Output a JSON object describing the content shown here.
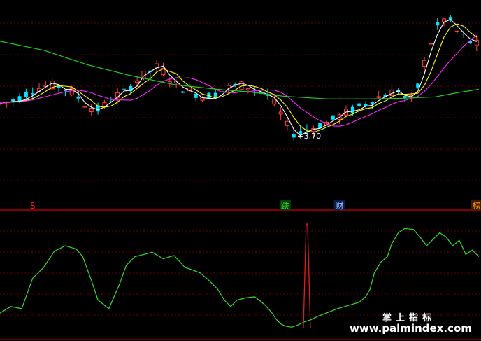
{
  "chart_data": [
    {
      "type": "candlestick",
      "panel": "main",
      "colors": {
        "up": "#ff3c3c",
        "down": "#00e5ff",
        "ma_white": "#ffffff",
        "ma_yellow": "#ffff00",
        "ma_magenta": "#ff22ff",
        "ma_green": "#22cc22",
        "grid": "#7a0000",
        "divider": "#cc0000"
      },
      "ylim": [
        2.6,
        5.6
      ],
      "low_marker": "3.70",
      "event_labels": [
        {
          "text": "S",
          "x": 15,
          "color": "#ff2222"
        },
        {
          "text": "跌",
          "x": 131,
          "color": "#33dd33",
          "bg": "#0b3d0b"
        },
        {
          "text": "财",
          "x": 156,
          "color": "#9bbcff",
          "bg": "#0a1d4d"
        },
        {
          "text": "榜",
          "x": 219,
          "color": "#ff8a00",
          "bg": "#3a1d00"
        }
      ],
      "candles": [],
      "ma_green": [
        [
          0,
          5.06
        ],
        [
          20,
          4.93
        ],
        [
          40,
          4.72
        ],
        [
          60,
          4.56
        ],
        [
          80,
          4.43
        ],
        [
          100,
          4.36
        ],
        [
          115,
          4.32
        ],
        [
          130,
          4.26
        ],
        [
          150,
          4.22
        ],
        [
          170,
          4.22
        ],
        [
          185,
          4.23
        ],
        [
          200,
          4.25
        ],
        [
          210,
          4.31
        ],
        [
          220,
          4.36
        ]
      ]
    },
    {
      "type": "line",
      "panel": "oscillator",
      "ylim": [
        0,
        100
      ],
      "spike": {
        "x": 141,
        "value": 100,
        "color": "#e02020"
      },
      "series": [
        {
          "color": "#33dd33",
          "values": [
            [
              0,
              18
            ],
            [
              5,
              24
            ],
            [
              10,
              22
            ],
            [
              15,
              50
            ],
            [
              20,
              60
            ],
            [
              25,
              75
            ],
            [
              30,
              80
            ],
            [
              35,
              77
            ],
            [
              38,
              70
            ],
            [
              42,
              48
            ],
            [
              45,
              30
            ],
            [
              50,
              22
            ],
            [
              55,
              45
            ],
            [
              58,
              62
            ],
            [
              62,
              70
            ],
            [
              66,
              72
            ],
            [
              70,
              74
            ],
            [
              75,
              68
            ],
            [
              80,
              71
            ],
            [
              85,
              60
            ],
            [
              88,
              58
            ],
            [
              92,
              55
            ],
            [
              96,
              48
            ],
            [
              100,
              40
            ],
            [
              103,
              30
            ],
            [
              106,
              24
            ],
            [
              109,
              30
            ],
            [
              113,
              32
            ],
            [
              117,
              33
            ],
            [
              119,
              30
            ],
            [
              122,
              25
            ],
            [
              125,
              18
            ],
            [
              127,
              12
            ],
            [
              129,
              8
            ],
            [
              131,
              6
            ],
            [
              134,
              5
            ],
            [
              137,
              7
            ],
            [
              140,
              10
            ],
            [
              143,
              12
            ],
            [
              146,
              15
            ],
            [
              150,
              18
            ],
            [
              155,
              22
            ],
            [
              160,
              25
            ],
            [
              165,
              28
            ],
            [
              168,
              33
            ],
            [
              170,
              40
            ],
            [
              172,
              55
            ],
            [
              175,
              65
            ],
            [
              178,
              70
            ],
            [
              180,
              82
            ],
            [
              183,
              92
            ],
            [
              186,
              96
            ],
            [
              190,
              95
            ],
            [
              193,
              88
            ],
            [
              196,
              80
            ],
            [
              199,
              86
            ],
            [
              202,
              92
            ],
            [
              205,
              88
            ],
            [
              208,
              80
            ],
            [
              211,
              85
            ],
            [
              214,
              72
            ],
            [
              217,
              76
            ],
            [
              220,
              70
            ]
          ]
        }
      ]
    }
  ],
  "watermark": {
    "cn": "掌上指标",
    "url": "www.palmindex.com"
  }
}
